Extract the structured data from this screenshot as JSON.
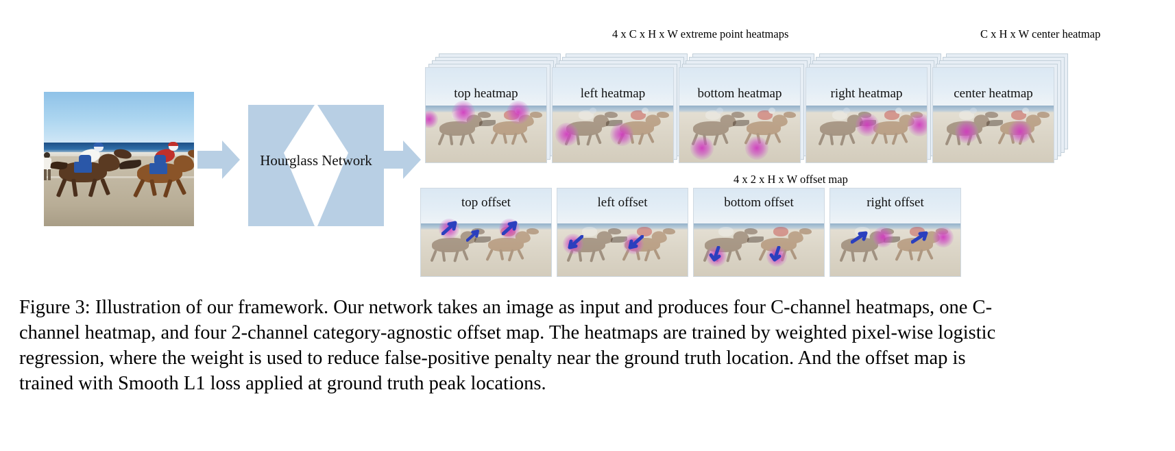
{
  "figure": {
    "id": "figure-3",
    "group_labels": {
      "extreme_heatmaps": "4 x C x H x W extreme point heatmaps",
      "center_heatmap": "C x H x W center heatmap",
      "offset_map": "4 x 2 x H x W offset map"
    },
    "network": {
      "label": "Hourglass Network",
      "block_color": "#b8cfe4"
    },
    "input": {
      "name": "input-image",
      "description": "two jockeys racing horses on a beach"
    },
    "heatmap_panels": [
      {
        "label": "top heatmap",
        "stacked": true,
        "stack_count": 5
      },
      {
        "label": "left heatmap",
        "stacked": true,
        "stack_count": 5
      },
      {
        "label": "bottom heatmap",
        "stacked": true,
        "stack_count": 5
      },
      {
        "label": "right heatmap",
        "stacked": true,
        "stack_count": 5
      },
      {
        "label": "center heatmap",
        "stacked": true,
        "stack_count": 5
      }
    ],
    "offset_panels": [
      {
        "label": "top offset",
        "stacked": false
      },
      {
        "label": "left offset",
        "stacked": false
      },
      {
        "label": "bottom offset",
        "stacked": false
      },
      {
        "label": "right offset",
        "stacked": false
      }
    ],
    "colors": {
      "block_blue": "#b8cfe4",
      "panel_sky": "#dce7f0",
      "heat_blob": "#d03cbe",
      "offset_arrow": "#2b3fbe"
    },
    "caption": {
      "line1": "Figure 3: Illustration of our framework. Our network takes an image as input and produces four C-channel heatmaps, one C-",
      "line2": "channel heatmap, and four 2-channel category-agnostic offset map. The heatmaps are trained by weighted pixel-wise logistic",
      "line3": "regression, where the weight is used to reduce false-positive penalty near the ground truth location. And the offset map is",
      "line4": "trained with Smooth L1 loss applied at ground truth peak locations."
    }
  }
}
